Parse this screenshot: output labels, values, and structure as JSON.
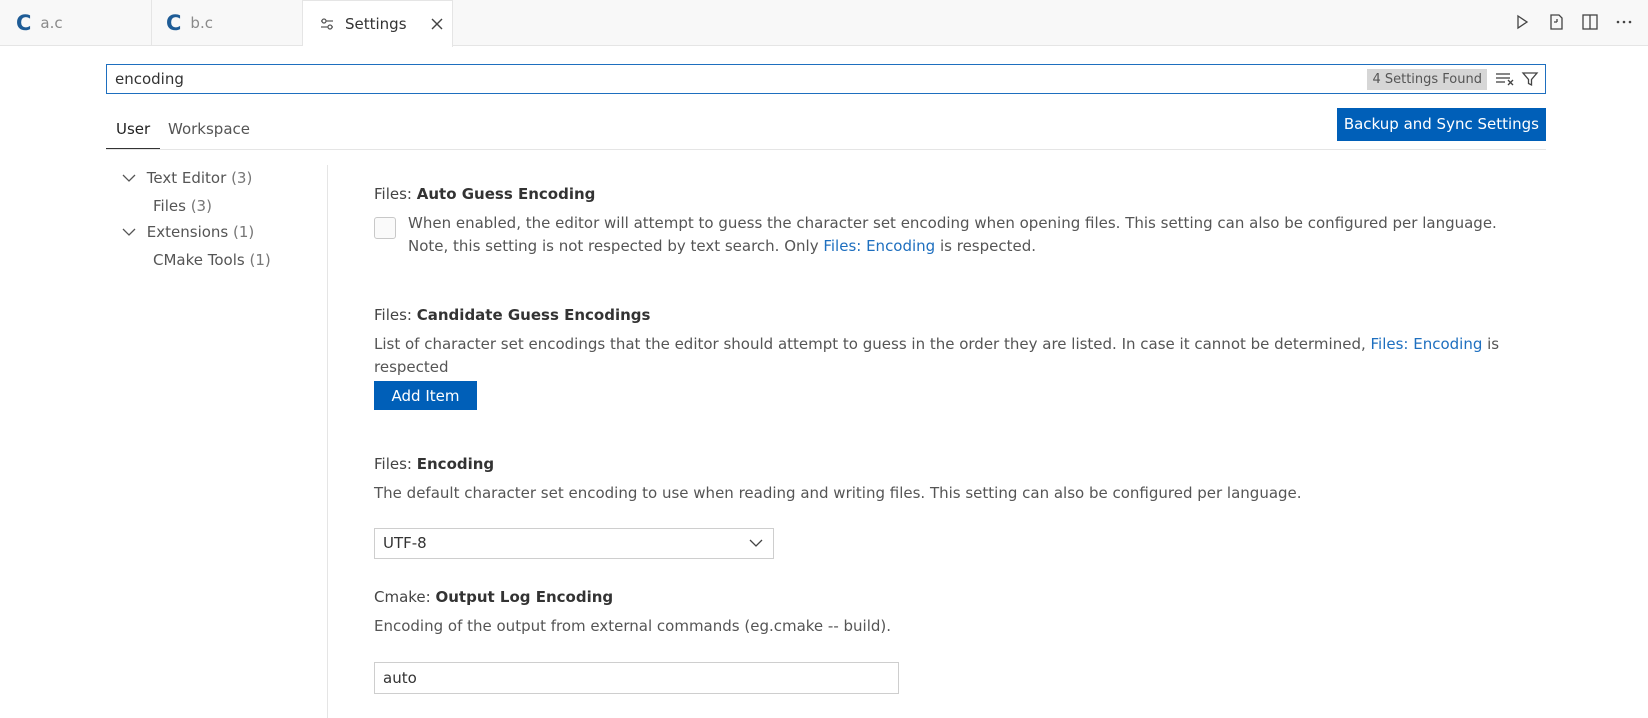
{
  "tabs": [
    {
      "label": "a.c",
      "icon": "c-language-icon",
      "icon_glyph": "C"
    },
    {
      "label": "b.c",
      "icon": "c-language-icon",
      "icon_glyph": "C"
    },
    {
      "label": "Settings",
      "icon": "settings-sliders-icon",
      "active": true
    }
  ],
  "tab_actions": [
    "run-icon",
    "open-settings-json-icon",
    "split-editor-icon",
    "more-actions-icon"
  ],
  "search": {
    "value": "encoding",
    "results_badge": "4 Settings Found"
  },
  "scope_tabs": [
    {
      "label": "User",
      "active": true
    },
    {
      "label": "Workspace",
      "active": false
    }
  ],
  "sync_button": "Backup and Sync Settings",
  "toc": [
    {
      "label": "Text Editor",
      "count": "(3)",
      "expanded": true,
      "level": 0
    },
    {
      "label": "Files",
      "count": "(3)",
      "level": 1
    },
    {
      "label": "Extensions",
      "count": "(1)",
      "expanded": true,
      "level": 0
    },
    {
      "label": "CMake Tools",
      "count": "(1)",
      "level": 1
    }
  ],
  "settings": [
    {
      "category": "Files: ",
      "name": "Auto Guess Encoding",
      "desc_before": "When enabled, the editor will attempt to guess the character set encoding when opening files. This setting can also be configured per language. Note, this setting is not respected by text search. Only ",
      "desc_link": "Files: Encoding",
      "desc_after": " is respected.",
      "checked": false
    },
    {
      "category": "Files: ",
      "name": "Candidate Guess Encodings",
      "desc_before": "List of character set encodings that the editor should attempt to guess in the order they are listed. In case it cannot be determined, ",
      "desc_link": "Files: Encoding",
      "desc_after": " is respected",
      "button": "Add Item"
    },
    {
      "category": "Files: ",
      "name": "Encoding",
      "desc": "The default character set encoding to use when reading and writing files. This setting can also be configured per language.",
      "value": "UTF-8"
    },
    {
      "category": "Cmake: ",
      "name": "Output Log Encoding",
      "desc": "Encoding of the output from external commands (eg.cmake -- build).",
      "value": "auto"
    }
  ],
  "colors": {
    "accent": "#005fb8",
    "link": "#1e6fbf",
    "c_icon": "#1e5c96"
  }
}
